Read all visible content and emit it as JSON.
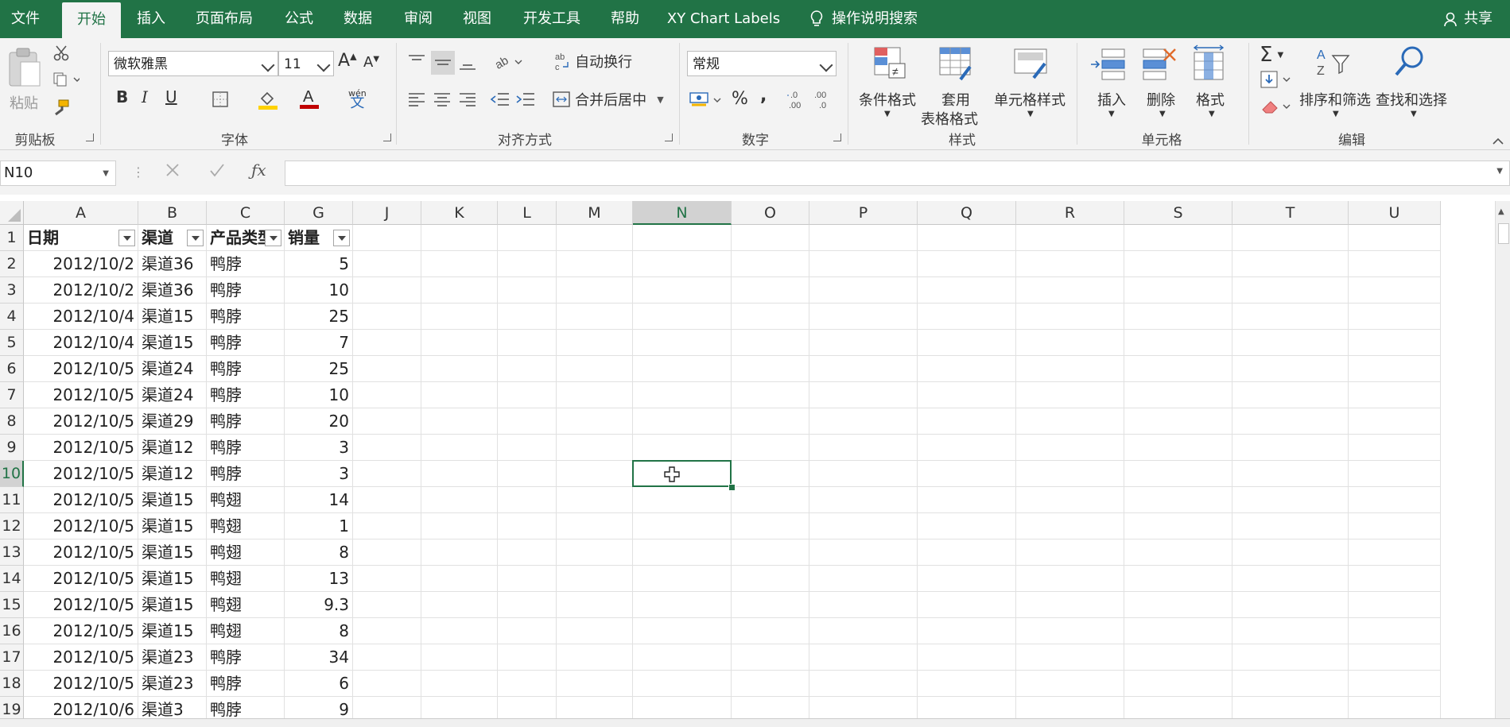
{
  "tabs": [
    {
      "label": "文件",
      "active": false
    },
    {
      "label": "开始",
      "active": true
    },
    {
      "label": "插入",
      "active": false
    },
    {
      "label": "页面布局",
      "active": false
    },
    {
      "label": "公式",
      "active": false
    },
    {
      "label": "数据",
      "active": false
    },
    {
      "label": "审阅",
      "active": false
    },
    {
      "label": "视图",
      "active": false
    },
    {
      "label": "开发工具",
      "active": false
    },
    {
      "label": "帮助",
      "active": false
    },
    {
      "label": "XY Chart Labels",
      "active": false
    }
  ],
  "help_search": "操作说明搜索",
  "share": "共享",
  "ribbon": {
    "clipboard": {
      "paste": "粘贴",
      "label": "剪贴板"
    },
    "font": {
      "name": "微软雅黑",
      "size": "11",
      "label": "字体",
      "bold": "B",
      "italic": "I",
      "underline": "U",
      "grow": "A",
      "shrink": "A",
      "phonetic": "wén"
    },
    "alignment": {
      "wrap": "自动换行",
      "merge": "合并后居中",
      "label": "对齐方式"
    },
    "number": {
      "format": "常规",
      "percent": "%",
      "comma": ",",
      "label": "数字"
    },
    "styles": {
      "conditional": "条件格式",
      "table_line1": "套用",
      "table_line2": "表格格式",
      "cell_styles": "单元格样式",
      "label": "样式"
    },
    "cells": {
      "insert": "插入",
      "delete": "删除",
      "format": "格式",
      "label": "单元格"
    },
    "editing": {
      "sort": "排序和筛选",
      "find": "查找和选择",
      "label": "编辑"
    }
  },
  "name_box": "N10",
  "columns": [
    "A",
    "B",
    "C",
    "G",
    "J",
    "K",
    "L",
    "M",
    "N",
    "O",
    "P",
    "Q",
    "R",
    "S",
    "T",
    "U"
  ],
  "selected_column": "N",
  "selected_row": 10,
  "header_row": [
    "日期",
    "渠道",
    "产品类型",
    "销量"
  ],
  "rows": [
    {
      "n": "2",
      "date": "2012/10/2",
      "channel": "渠道36",
      "product": "鸭脖",
      "sales": "5"
    },
    {
      "n": "3",
      "date": "2012/10/2",
      "channel": "渠道36",
      "product": "鸭脖",
      "sales": "10"
    },
    {
      "n": "4",
      "date": "2012/10/4",
      "channel": "渠道15",
      "product": "鸭脖",
      "sales": "25"
    },
    {
      "n": "5",
      "date": "2012/10/4",
      "channel": "渠道15",
      "product": "鸭脖",
      "sales": "7"
    },
    {
      "n": "6",
      "date": "2012/10/5",
      "channel": "渠道24",
      "product": "鸭脖",
      "sales": "25"
    },
    {
      "n": "7",
      "date": "2012/10/5",
      "channel": "渠道24",
      "product": "鸭脖",
      "sales": "10"
    },
    {
      "n": "8",
      "date": "2012/10/5",
      "channel": "渠道29",
      "product": "鸭脖",
      "sales": "20"
    },
    {
      "n": "9",
      "date": "2012/10/5",
      "channel": "渠道12",
      "product": "鸭脖",
      "sales": "3"
    },
    {
      "n": "10",
      "date": "2012/10/5",
      "channel": "渠道12",
      "product": "鸭脖",
      "sales": "3"
    },
    {
      "n": "11",
      "date": "2012/10/5",
      "channel": "渠道15",
      "product": "鸭翅",
      "sales": "14"
    },
    {
      "n": "12",
      "date": "2012/10/5",
      "channel": "渠道15",
      "product": "鸭翅",
      "sales": "1"
    },
    {
      "n": "13",
      "date": "2012/10/5",
      "channel": "渠道15",
      "product": "鸭翅",
      "sales": "8"
    },
    {
      "n": "14",
      "date": "2012/10/5",
      "channel": "渠道15",
      "product": "鸭翅",
      "sales": "13"
    },
    {
      "n": "15",
      "date": "2012/10/5",
      "channel": "渠道15",
      "product": "鸭翅",
      "sales": "9.3"
    },
    {
      "n": "16",
      "date": "2012/10/5",
      "channel": "渠道15",
      "product": "鸭翅",
      "sales": "8"
    },
    {
      "n": "17",
      "date": "2012/10/5",
      "channel": "渠道23",
      "product": "鸭脖",
      "sales": "34"
    },
    {
      "n": "18",
      "date": "2012/10/5",
      "channel": "渠道23",
      "product": "鸭脖",
      "sales": "6"
    },
    {
      "n": "19",
      "date": "2012/10/6",
      "channel": "渠道3",
      "product": "鸭脖",
      "sales": "9"
    }
  ],
  "colors": {
    "accent": "#217346",
    "ribbon_bg": "#f3f3f3",
    "font_color_red": "#c00000",
    "highlight_yellow": "#ffd200"
  }
}
